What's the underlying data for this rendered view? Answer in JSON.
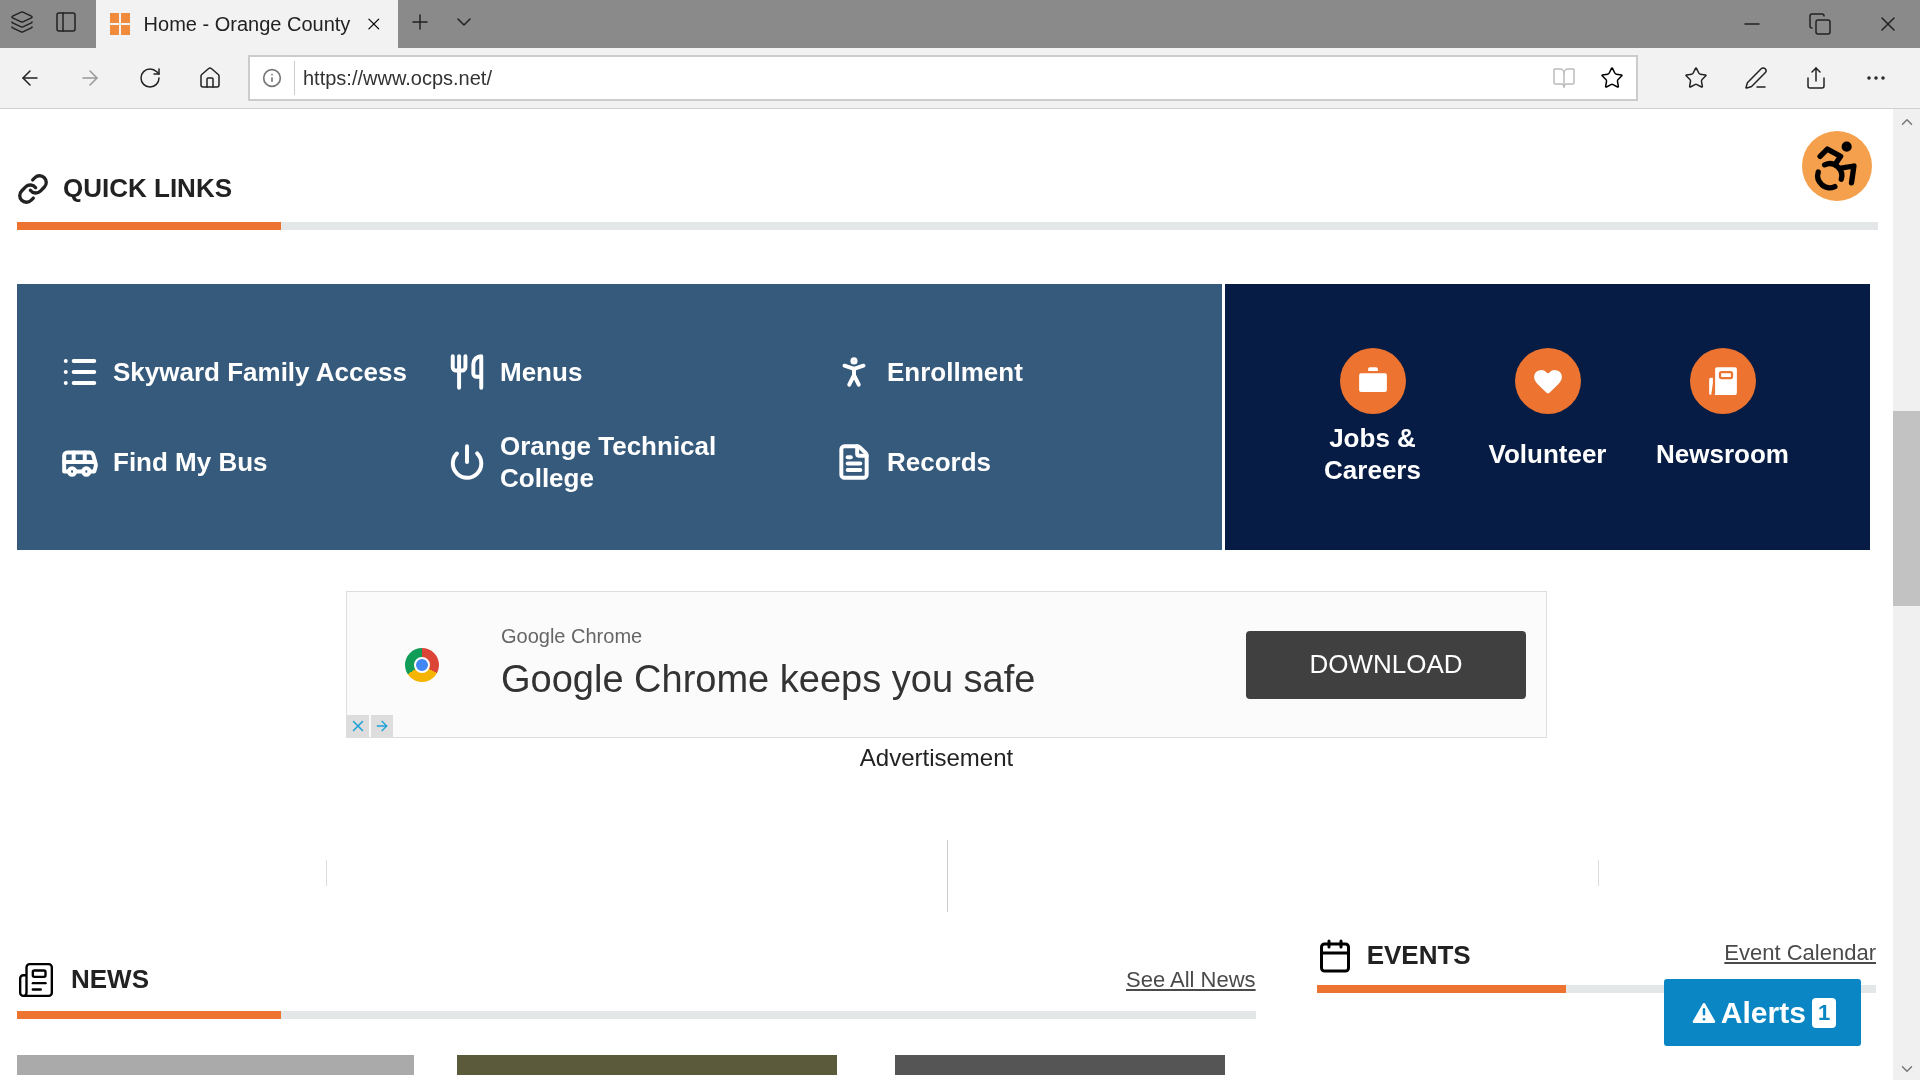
{
  "browser": {
    "tabs": [
      {
        "title": "Home - Orange County",
        "selected": true
      }
    ],
    "url": "https://www.ocps.net/"
  },
  "quick_links": {
    "title": "QUICK LINKS",
    "links": [
      {
        "label": "Skyward Family Access"
      },
      {
        "label": "Menus"
      },
      {
        "label": "Enrollment"
      },
      {
        "label": "Find My Bus"
      },
      {
        "label": "Orange Technical College"
      },
      {
        "label": "Records"
      }
    ],
    "featured": [
      {
        "label": "Jobs & Careers"
      },
      {
        "label": "Volunteer"
      },
      {
        "label": "Newsroom"
      }
    ]
  },
  "ad": {
    "advertiser": "Google Chrome",
    "headline": "Google Chrome keeps you safe",
    "button": "DOWNLOAD",
    "caption": "Advertisement"
  },
  "news": {
    "title": "NEWS",
    "link": "See All News"
  },
  "events": {
    "title": "EVENTS",
    "link": "Event Calendar"
  },
  "alerts": {
    "label": "Alerts",
    "count": "1"
  }
}
